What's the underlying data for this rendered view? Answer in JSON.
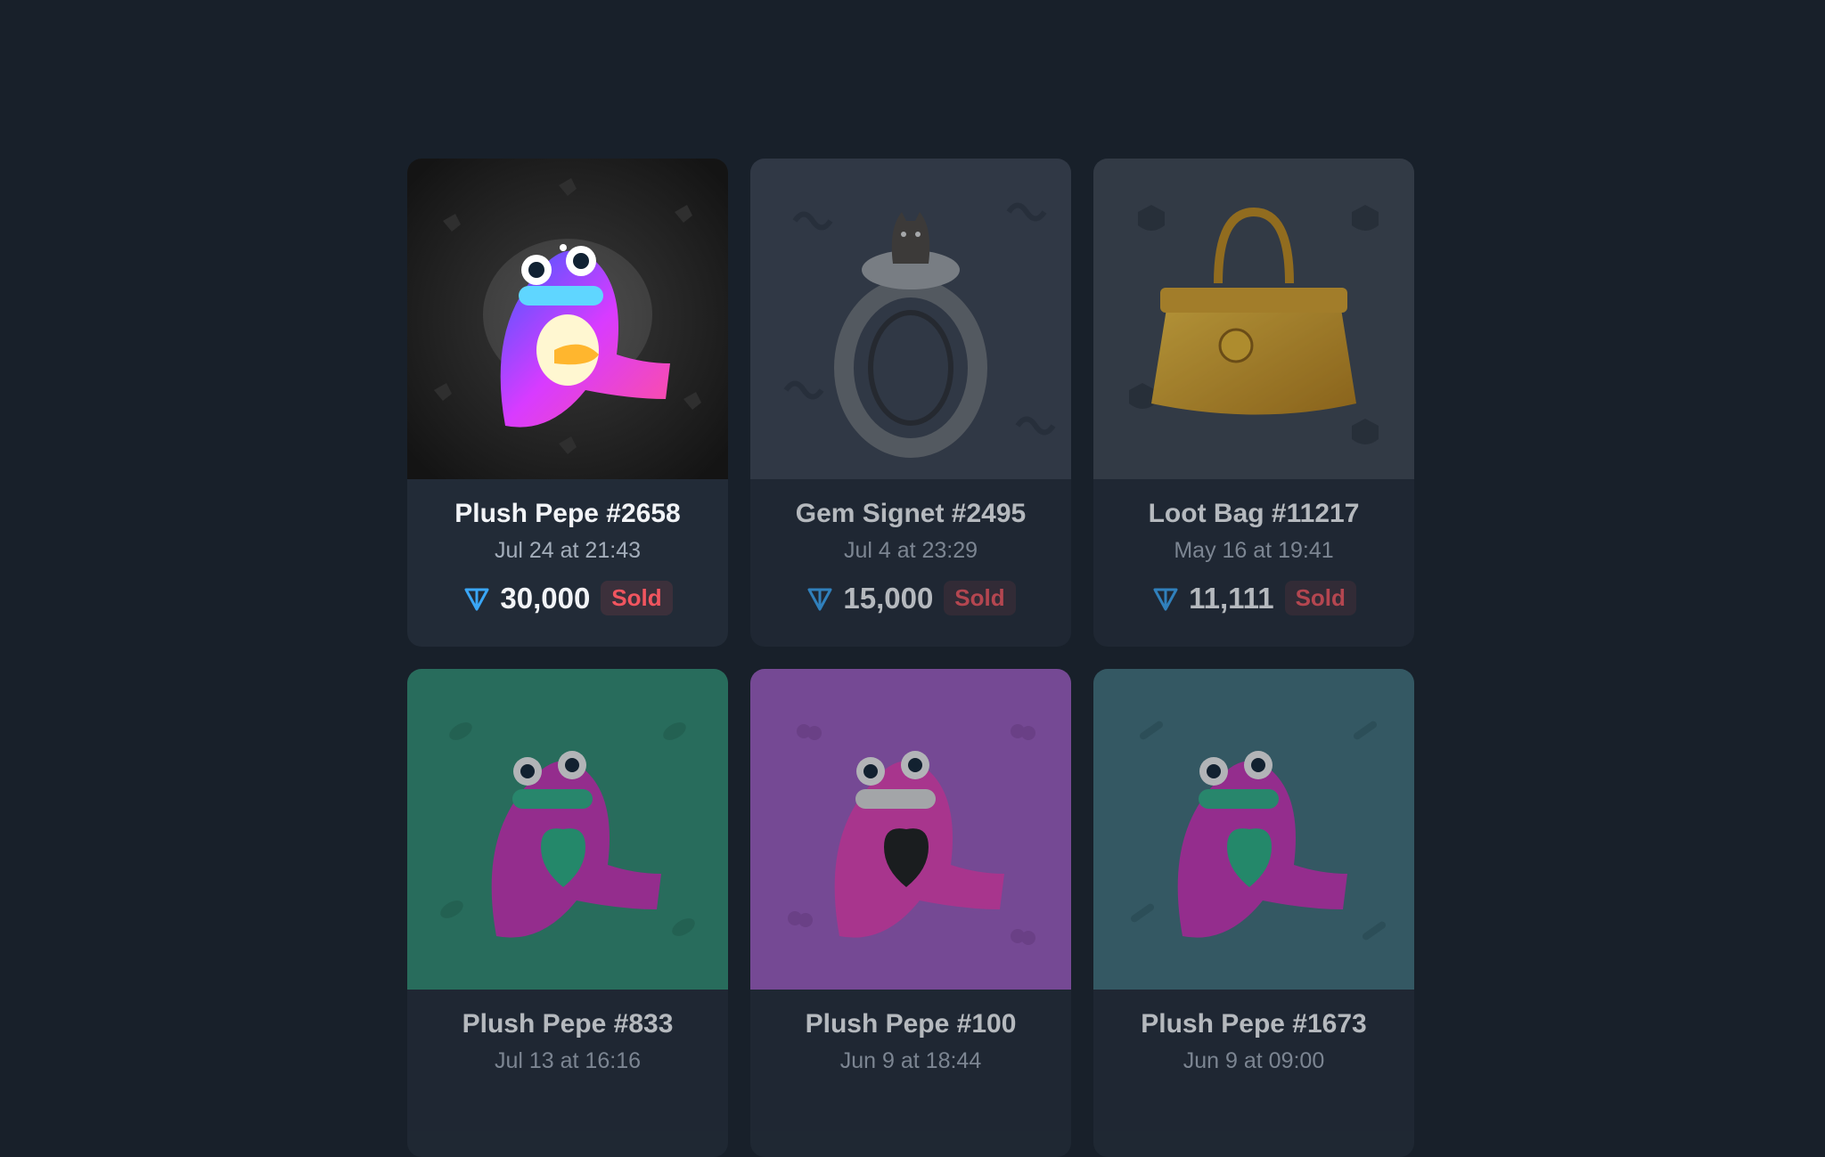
{
  "currency_icon": "ton-diamond-icon",
  "cards": [
    {
      "title": "Plush Pepe #2658",
      "date": "Jul 24 at 21:43",
      "price": "30,000",
      "status": "Sold",
      "background": "#1e1e1e",
      "pattern_icon": "pegasus-icon",
      "art_icon": "rainbow-plush-pepe-icon"
    },
    {
      "title": "Gem Signet #2495",
      "date": "Jul 4 at 23:29",
      "price": "15,000",
      "status": "Sold",
      "background": "#3a4250",
      "pattern_icon": "snake-icon",
      "art_icon": "silver-ring-with-cat-icon"
    },
    {
      "title": "Loot Bag #11217",
      "date": "May 16 at 19:41",
      "price": "11,111",
      "status": "Sold",
      "background": "#3d4550",
      "pattern_icon": "shield-icon",
      "art_icon": "gold-handbag-icon"
    },
    {
      "title": "Plush Pepe #833",
      "date": "Jul 13 at 16:16",
      "price": "",
      "status": "",
      "background": "#2f8a70",
      "pattern_icon": "leaf-icon",
      "art_icon": "purple-plush-pepe-green-heart-icon"
    },
    {
      "title": "Plush Pepe #100",
      "date": "Jun 9 at 18:44",
      "price": "",
      "status": "",
      "background": "#9a59bd",
      "pattern_icon": "cherry-icon",
      "art_icon": "pink-plush-pepe-black-heart-icon"
    },
    {
      "title": "Plush Pepe #1673",
      "date": "Jun 9 at 09:00",
      "price": "",
      "status": "",
      "background": "#3f6e79",
      "pattern_icon": "bone-icon",
      "art_icon": "purple-plush-pepe-green-heart-icon"
    }
  ]
}
